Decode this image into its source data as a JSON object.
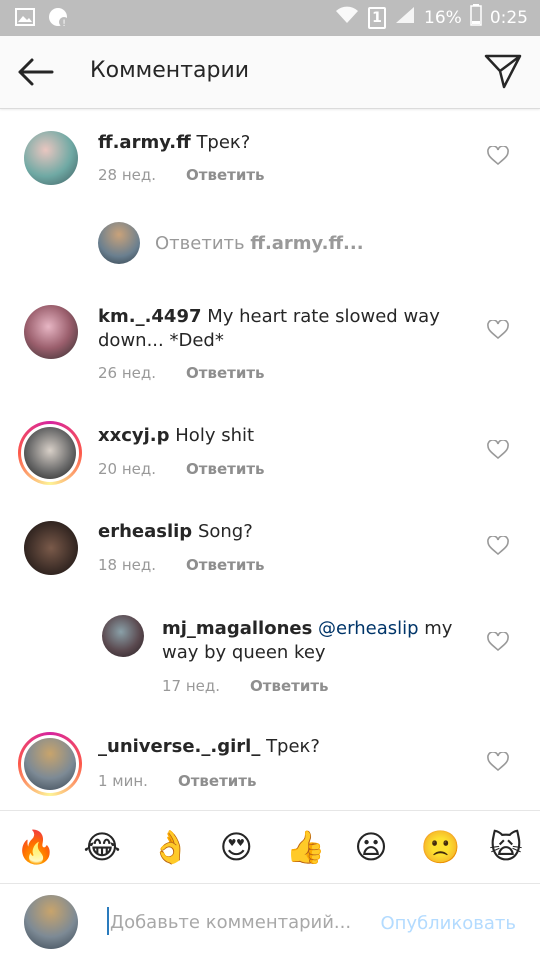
{
  "status_bar": {
    "battery": "16%",
    "time": "0:25",
    "sim": "1"
  },
  "header": {
    "title": "Комментарии"
  },
  "comments": [
    {
      "username": "ff.army.ff",
      "text": "Трек?",
      "time": "28 нед.",
      "reply_label": "Ответить"
    },
    {
      "username": "km._.4497",
      "text": "My heart rate slowed way down... *Ded*",
      "time": "26 нед.",
      "reply_label": "Ответить"
    },
    {
      "username": "xxcyj.p",
      "text": "Holy shit",
      "time": "20 нед.",
      "reply_label": "Ответить"
    },
    {
      "username": "erheaslip",
      "text": "Song?",
      "time": "18 нед.",
      "reply_label": "Ответить"
    },
    {
      "username": "mj_magallones",
      "mention": "@erheaslip",
      "text": "my way by queen key",
      "time": "17 нед.",
      "reply_label": "Ответить"
    },
    {
      "username": "_universe._.girl_",
      "text": "Трек?",
      "time": "1 мин.",
      "reply_label": "Ответить"
    }
  ],
  "reply_prompt": {
    "label": "Ответить",
    "target": "ff.army.ff..."
  },
  "emoji_bar": [
    "🔥",
    "😂",
    "👌",
    "😍",
    "👍",
    "😦",
    "🙁",
    "🙀"
  ],
  "composer": {
    "placeholder": "Добавьте комментарий...",
    "value": "",
    "publish_label": "Опубликовать"
  },
  "colors": {
    "status_bar": "#bdbdbd",
    "mention": "#003569",
    "publish_disabled": "#b3dbff"
  }
}
